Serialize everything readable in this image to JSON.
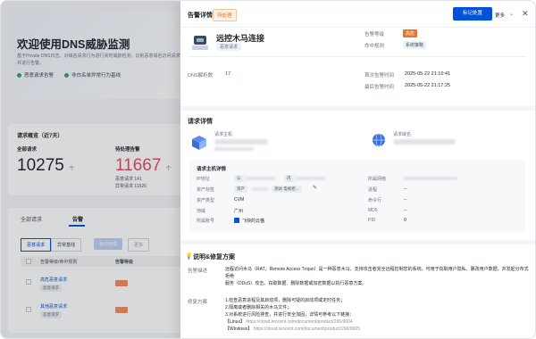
{
  "background": {
    "hero_title": "欢迎使用DNS威胁监测",
    "hero_desc": "基于Private DNS日志，对域名请求行为进行实时威胁检测，识别恶意域名访问请求行为，并进行告警。",
    "link_rules": "恶意请求告警",
    "link_whitelist": "非白名单异常行为基线",
    "stats_title": "请求概览（近7天）",
    "stat_total_label": "全部请求",
    "stat_total_value": "10275",
    "stat_total_unit": "个",
    "stat_pending_label": "待处理告警",
    "stat_pending_value": "11667",
    "stat_pending_unit": "个",
    "stat_line1": "恶意请求 141",
    "stat_line2": "异常请求 11526",
    "tab_all": "全部请求",
    "tab_alert": "告警",
    "seg_malicious": "恶意请求",
    "seg_abnormal": "异常基线",
    "btn_batch": "标记处理",
    "btn_more": "更多",
    "col_event": "告警等级/命中规则",
    "col_level": "告警等级",
    "rows": [
      {
        "link": "高危恶意请求",
        "tag": "恶意请求"
      },
      {
        "link": "其他恶意请求",
        "tag": "恶意请求"
      }
    ]
  },
  "drawer": {
    "title": "告警详情",
    "status_badge": "待处理",
    "primary_button": "标记处置",
    "more_button": "更多",
    "close_icon_glyph": "✕",
    "event_name": "远控木马连接",
    "event_tag": "恶意请求",
    "level_label": "告警等级",
    "level_value": "高危",
    "rule_label": "命中规则",
    "rule_value": "系统策略",
    "dns_count_label": "DNS解析数",
    "dns_count_value": "17",
    "first_time_label": "首次告警时间",
    "first_time_value": "2025-05-22 21:10:41",
    "last_time_label": "最后告警时间",
    "last_time_value": "2025-05-22 21:17:25",
    "request_section": "请求详情",
    "host_label": "请求主机",
    "domain_label": "请求域名",
    "host_detail_title": "请求主机详情",
    "ip_label": "IP地址",
    "ip_tag1": "公",
    "ip_tag2": "内",
    "asset_tag_label": "资产标签",
    "asset_tag1": "资产",
    "asset_tag2": "测试 电视柜...",
    "asset_type_label": "资产类型",
    "asset_type_value": "CVM",
    "region_label": "地域",
    "region_value": "广州",
    "account_label": "所属账号",
    "account_value": "飞快的云猫",
    "network_label": "所属网络",
    "process_label": "进程",
    "process_value": "--",
    "cmd_label": "命令行",
    "cmd_value": "--",
    "md5_label": "MD5",
    "md5_value": "--",
    "pid_label": "PID",
    "pid_value": "0",
    "fix_section": "说明&修复方案",
    "desc_label": "告警描述",
    "desc_line1": "远程访问木马（RAT，Remote Access Trojan）是一种恶意木马，支持攻击者完全远程控制您的系统。可用于窃取用户隐私、篡改用户数据，并发起分布式拒绝",
    "desc_line2": "服务（DDoS）攻击。窃取数据、删除数据或加密数据以执行恶意方案。",
    "fix_label": "修复方案",
    "fix_line1": "1.检查恶意进程及其启动项，删除可疑的启动项或定时任务；",
    "fix_line2": "2.隔离或者删除相关的木马文件；",
    "fix_line3": "3.对系统进行风险排查，并进行安全加固，详情可参考以下链接：",
    "fix_line4_prefix": "【Linux】",
    "fix_line4_link": "https://cloud.tencent.com/document/product/296/9604",
    "fix_line5_prefix": "【Windows】",
    "fix_line5_link": "https://cloud.tencent.com/document/product/296/9605"
  },
  "colors": {
    "primary": "#0052d9",
    "danger": "#e34d59",
    "warning": "#e8752f",
    "success": "#2ba471"
  }
}
